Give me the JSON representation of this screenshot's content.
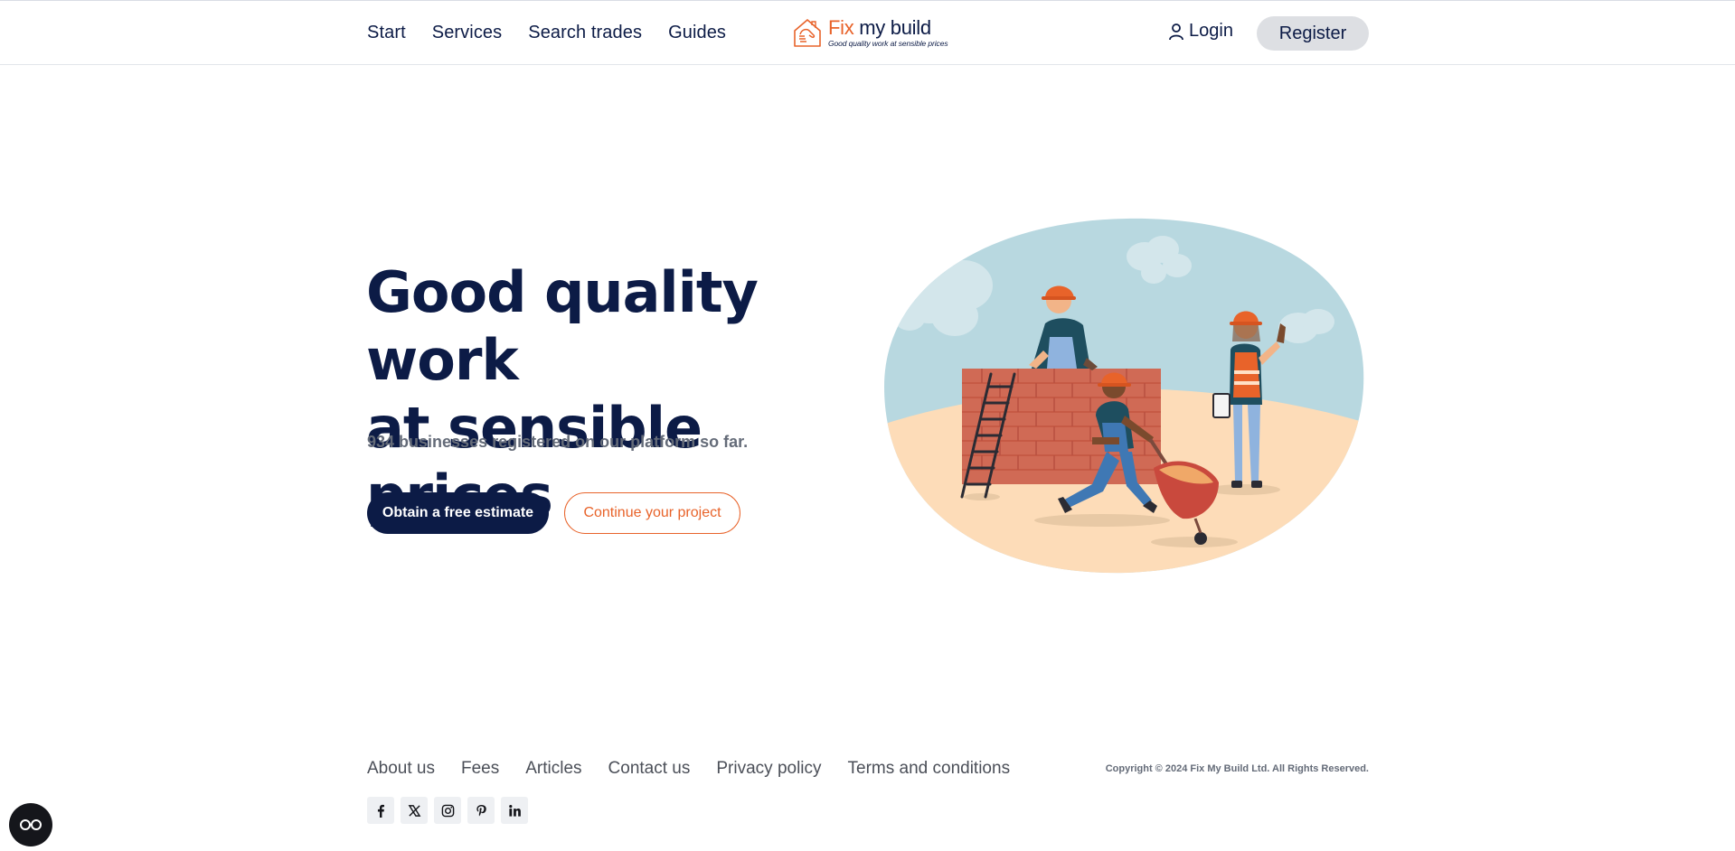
{
  "header": {
    "nav": [
      "Start",
      "Services",
      "Search trades",
      "Guides"
    ],
    "logo": {
      "fix": "Fix",
      "rest": " my build",
      "tagline": "Good quality work at sensible prices"
    },
    "login_label": "Login",
    "register_label": "Register"
  },
  "hero": {
    "title_line1": "Good quality work",
    "title_line2": "at sensible prices",
    "subtitle": "934 businesses registered on our platform so far.",
    "primary_button": "Obtain a free estimate",
    "secondary_button": "Continue your project"
  },
  "footer": {
    "links": [
      "About us",
      "Fees",
      "Articles",
      "Contact us",
      "Privacy policy",
      "Terms and conditions"
    ],
    "copyright": "Copyright © 2024 Fix My Build Ltd. All Rights Reserved.",
    "socials": [
      "facebook-icon",
      "x-icon",
      "instagram-icon",
      "pinterest-icon",
      "linkedin-icon"
    ]
  },
  "colors": {
    "navy": "#0c1b46",
    "accent": "#e8632a",
    "sky": "#b8d8e0",
    "sand": "#fddcb8"
  }
}
